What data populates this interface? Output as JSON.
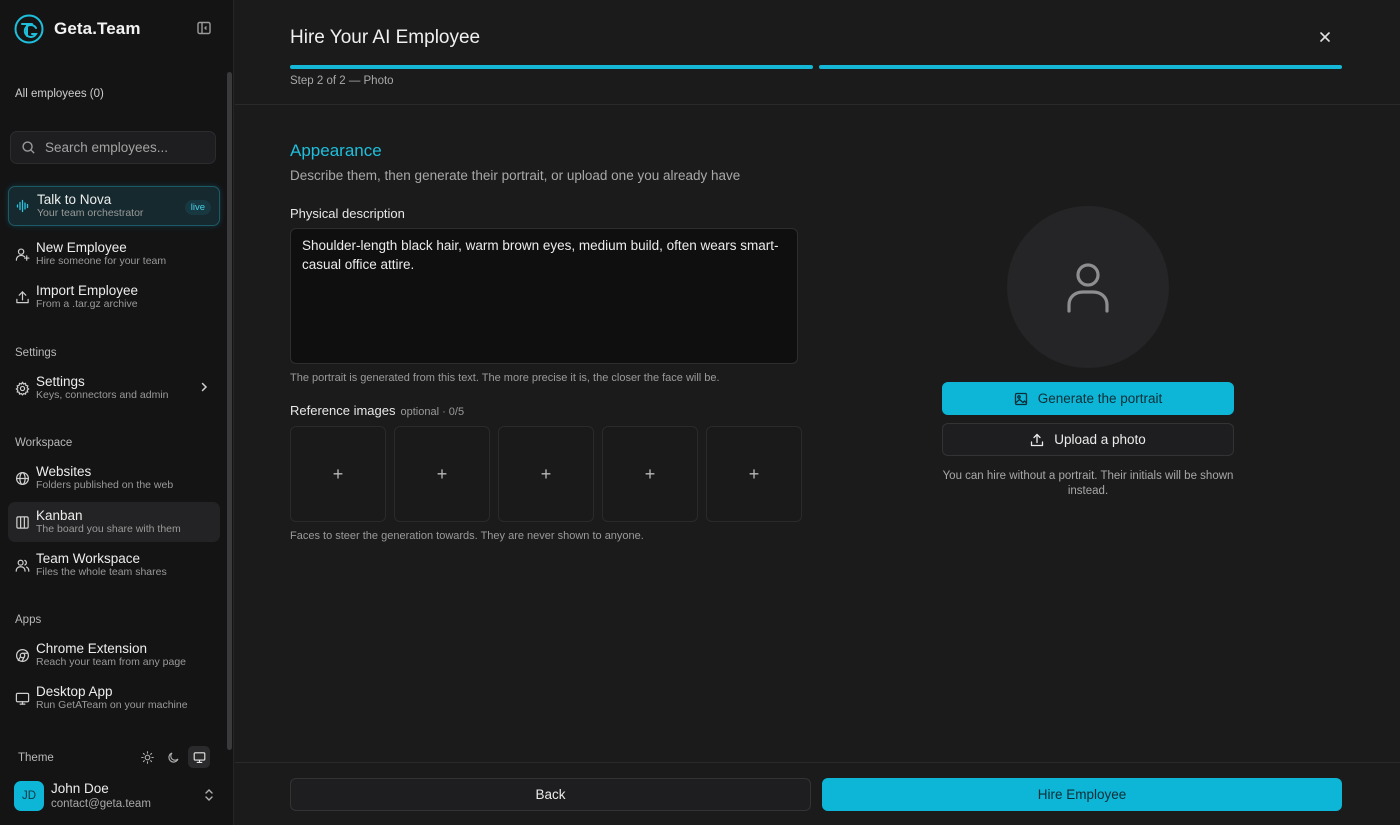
{
  "sidebar": {
    "brand": "Geta.Team",
    "all_employees": "All employees (0)",
    "search_placeholder": "Search employees...",
    "top_items": [
      {
        "title": "Talk to Nova",
        "subtitle": "Your team orchestrator",
        "badge": "live",
        "icon": "waveform-icon"
      },
      {
        "title": "New Employee",
        "subtitle": "Hire someone for your team",
        "icon": "user-plus-icon"
      },
      {
        "title": "Import Employee",
        "subtitle": "From a .tar.gz archive",
        "icon": "upload-icon"
      }
    ],
    "settings_label": "Settings",
    "settings_item": {
      "title": "Settings",
      "subtitle": "Keys, connectors and admin",
      "icon": "gear-icon"
    },
    "workspace_label": "Workspace",
    "workspace_items": [
      {
        "title": "Websites",
        "subtitle": "Folders published on the web",
        "icon": "globe-icon"
      },
      {
        "title": "Kanban",
        "subtitle": "The board you share with them",
        "icon": "kanban-icon"
      },
      {
        "title": "Team Workspace",
        "subtitle": "Files the whole team shares",
        "icon": "users-icon"
      }
    ],
    "apps_label": "Apps",
    "apps_items": [
      {
        "title": "Chrome Extension",
        "subtitle": "Reach your team from any page",
        "icon": "chrome-icon"
      },
      {
        "title": "Desktop App",
        "subtitle": "Run GetATeam on your machine",
        "icon": "monitor-icon"
      }
    ],
    "theme_label": "Theme",
    "user": {
      "initials": "JD",
      "name": "John Doe",
      "email": "contact@geta.team"
    }
  },
  "dialog": {
    "title": "Hire Your AI Employee",
    "step_label": "Step 2 of 2 — Photo",
    "steps_total": 2,
    "steps_completed": 2,
    "section_title": "Appearance",
    "section_subtitle": "Describe them, then generate their portrait, or upload one you already have",
    "description_label": "Physical description",
    "description_value": "Shoulder-length black hair, warm brown eyes, medium build, often wears smart-casual office attire.",
    "description_help": "The portrait is generated from this text. The more precise it is, the closer the face will be.",
    "reference_label": "Reference images",
    "reference_optional": "optional · 0/5",
    "reference_slots": [
      "+",
      "+",
      "+",
      "+",
      "+"
    ],
    "reference_help": "Faces to steer the generation towards. They are never shown to anyone.",
    "generate_label": "Generate the portrait",
    "upload_label": "Upload a photo",
    "portrait_note": "You can hire without a portrait. Their initials will be shown instead.",
    "back_label": "Back",
    "hire_label": "Hire Employee"
  },
  "colors": {
    "accent": "#0db5d6",
    "background": "#1b1b1c",
    "sidebar": "#141415"
  }
}
